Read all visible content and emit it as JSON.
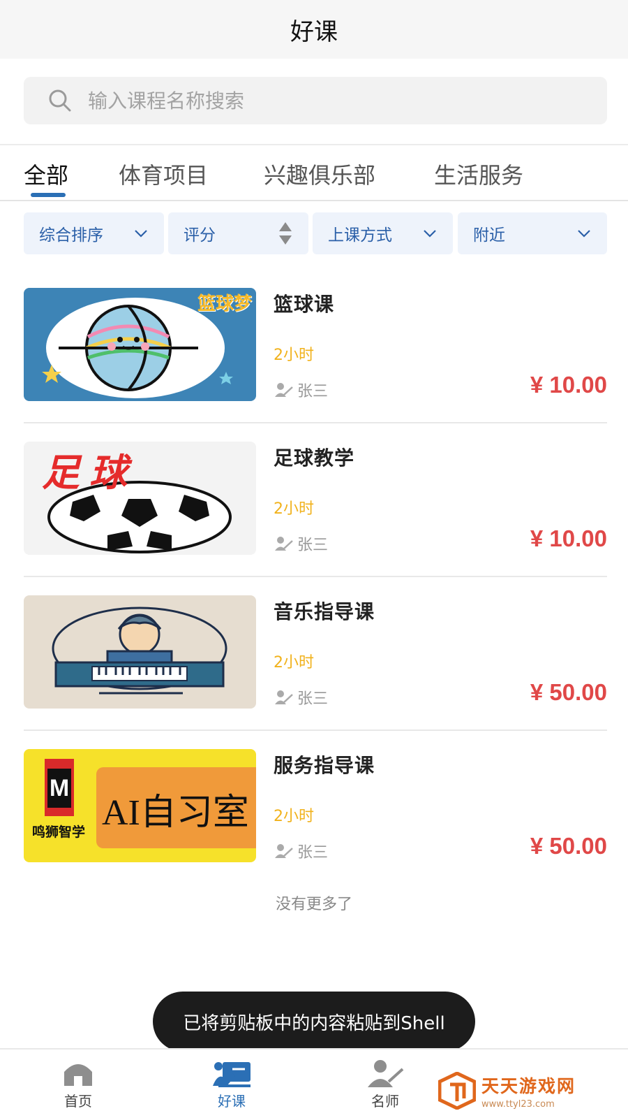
{
  "header": {
    "title": "好课"
  },
  "search": {
    "placeholder": "输入课程名称搜索"
  },
  "tabs": [
    {
      "label": "全部",
      "active": true
    },
    {
      "label": "体育项目",
      "active": false
    },
    {
      "label": "兴趣俱乐部",
      "active": false
    },
    {
      "label": "生活服务",
      "active": false
    }
  ],
  "filters": [
    {
      "label": "综合排序",
      "icon": "chevron-down-icon"
    },
    {
      "label": "评分",
      "icon": "sort-arrows-icon"
    },
    {
      "label": "上课方式",
      "icon": "chevron-down-icon"
    },
    {
      "label": "附近",
      "icon": "chevron-down-icon"
    }
  ],
  "courses": [
    {
      "title": "篮球课",
      "duration": "2小时",
      "teacher": "张三",
      "price": "¥ 10.00",
      "image_text": "篮球梦"
    },
    {
      "title": "足球教学",
      "duration": "2小时",
      "teacher": "张三",
      "price": "¥ 10.00",
      "image_text": "足球"
    },
    {
      "title": "音乐指导课",
      "duration": "2小时",
      "teacher": "张三",
      "price": "¥ 50.00"
    },
    {
      "title": "服务指导课",
      "duration": "2小时",
      "teacher": "张三",
      "price": "¥ 50.00",
      "image_text": "AI自习室",
      "image_logo_letter": "M",
      "image_logo_text": "鸣狮智学"
    }
  ],
  "list_end": "没有更多了",
  "toast": "已将剪贴板中的内容粘贴到Shell",
  "bottom_nav": [
    {
      "label": "首页",
      "icon": "home-icon",
      "active": false
    },
    {
      "label": "好课",
      "icon": "course-icon",
      "active": true
    },
    {
      "label": "名师",
      "icon": "teacher-icon",
      "active": false
    }
  ],
  "watermark": {
    "name": "天天游戏网",
    "url": "www.ttyl23.com"
  },
  "colors": {
    "accent": "#2b6fb5",
    "price": "#e04848",
    "duration": "#f1b21c",
    "filter_bg": "#eef3fb"
  }
}
